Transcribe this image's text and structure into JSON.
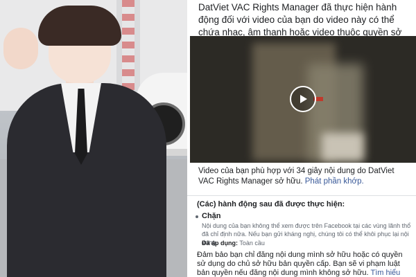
{
  "notice": {
    "intro": "DatViet VAC Rights Manager đã thực hiện hành động đối với video của bạn do video này có thể chứa nhạc, âm thanh hoặc video thuộc quyền sở hữu của họ.",
    "video_caption": "Video của bạn phù hợp với 34 giây nội dung do DatViet VAC Rights Manager sở hữu.",
    "video_link": "Phát phần khớp.",
    "actions_title": "(Các) hành động sau đã được thực hiện:",
    "action": {
      "title": "Chặn",
      "description": "Nội dung của bạn không thể xem được trên Facebook tại các vùng lãnh thổ đã chỉ định nữa. Nếu bạn gửi kháng nghị, chúng tôi có thể khôi phục lại nội dung.",
      "applied_label": "Đã áp dụng:",
      "applied_value": "Toàn cầu"
    },
    "footer_text": "Đảm bảo bạn chỉ đăng nội dung mình sở hữu hoặc có quyền sử dụng do chủ sở hữu bản quyền cấp. Bạn sẽ vi phạm luật bản quyền nếu đăng nội dung mình không sở hữu.",
    "footer_link": "Tìm hiểu thêm."
  },
  "icons": {
    "play": "play-icon"
  },
  "colors": {
    "link": "#385898",
    "text": "#1c1e21",
    "muted": "#606770"
  }
}
